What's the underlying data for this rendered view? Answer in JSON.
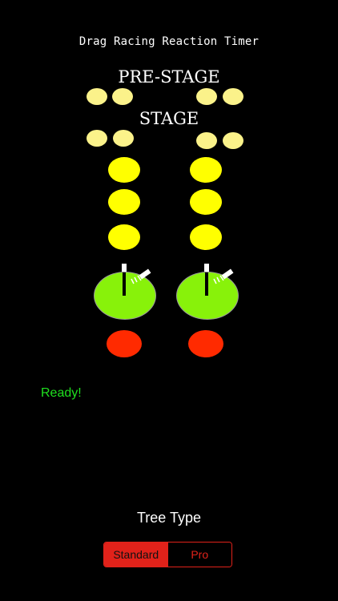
{
  "app": {
    "title": "Drag Racing Reaction Timer"
  },
  "tree": {
    "prestage_label": "PRE-STAGE",
    "stage_label": "STAGE",
    "lanes": [
      "left",
      "right"
    ],
    "colors": {
      "prestage": "#fbf28a",
      "stage": "#fbf28a",
      "amber": "#ffff00",
      "green": "#88f20a",
      "red": "#ff2a00"
    }
  },
  "status": {
    "text": "Ready!",
    "color": "#1fe01f"
  },
  "tree_type": {
    "label": "Tree Type",
    "options": [
      "Standard",
      "Pro"
    ],
    "selected": "Standard",
    "accent": "#e1221a"
  }
}
